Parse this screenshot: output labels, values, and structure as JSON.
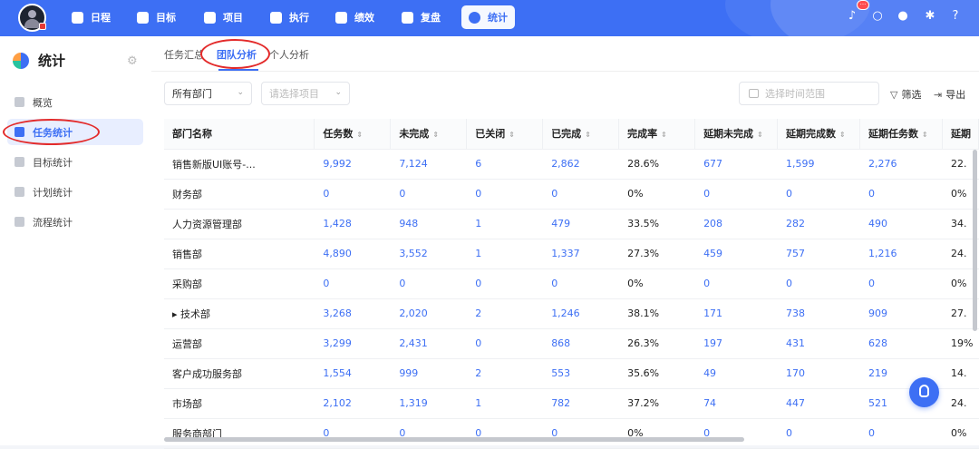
{
  "nav": {
    "items": [
      {
        "label": "日程"
      },
      {
        "label": "目标"
      },
      {
        "label": "项目"
      },
      {
        "label": "执行"
      },
      {
        "label": "绩效"
      },
      {
        "label": "复盘"
      },
      {
        "label": "统计"
      }
    ],
    "badge": "···",
    "accent": "#3d6ff4"
  },
  "sidebar": {
    "title": "统计",
    "items": [
      {
        "label": "概览"
      },
      {
        "label": "任务统计"
      },
      {
        "label": "目标统计"
      },
      {
        "label": "计划统计"
      },
      {
        "label": "流程统计"
      }
    ]
  },
  "tabs": [
    {
      "label": "任务汇总"
    },
    {
      "label": "团队分析"
    },
    {
      "label": "个人分析"
    }
  ],
  "filters": {
    "department": "所有部门",
    "project_placeholder": "请选择项目",
    "date_placeholder": "选择时间范围",
    "filter_label": "筛选",
    "export_label": "导出"
  },
  "table": {
    "headers": [
      "部门名称",
      "任务数",
      "未完成",
      "已关闭",
      "已完成",
      "完成率",
      "延期未完成",
      "延期完成数",
      "延期任务数",
      "延期"
    ],
    "rows": [
      [
        "销售新版UI账号-...",
        "9,992",
        "7,124",
        "6",
        "2,862",
        "28.6%",
        "677",
        "1,599",
        "2,276",
        "22."
      ],
      [
        "财务部",
        "0",
        "0",
        "0",
        "0",
        "0%",
        "0",
        "0",
        "0",
        "0%"
      ],
      [
        "人力资源管理部",
        "1,428",
        "948",
        "1",
        "479",
        "33.5%",
        "208",
        "282",
        "490",
        "34."
      ],
      [
        "销售部",
        "4,890",
        "3,552",
        "1",
        "1,337",
        "27.3%",
        "459",
        "757",
        "1,216",
        "24."
      ],
      [
        "采购部",
        "0",
        "0",
        "0",
        "0",
        "0%",
        "0",
        "0",
        "0",
        "0%"
      ],
      [
        "▸ 技术部",
        "3,268",
        "2,020",
        "2",
        "1,246",
        "38.1%",
        "171",
        "738",
        "909",
        "27."
      ],
      [
        "运营部",
        "3,299",
        "2,431",
        "0",
        "868",
        "26.3%",
        "197",
        "431",
        "628",
        "19%"
      ],
      [
        "客户成功服务部",
        "1,554",
        "999",
        "2",
        "553",
        "35.6%",
        "49",
        "170",
        "219",
        "14."
      ],
      [
        "市场部",
        "2,102",
        "1,319",
        "1",
        "782",
        "37.2%",
        "74",
        "447",
        "521",
        "24."
      ],
      [
        "服务商部门",
        "0",
        "0",
        "0",
        "0",
        "0%",
        "0",
        "0",
        "0",
        "0%"
      ]
    ]
  }
}
